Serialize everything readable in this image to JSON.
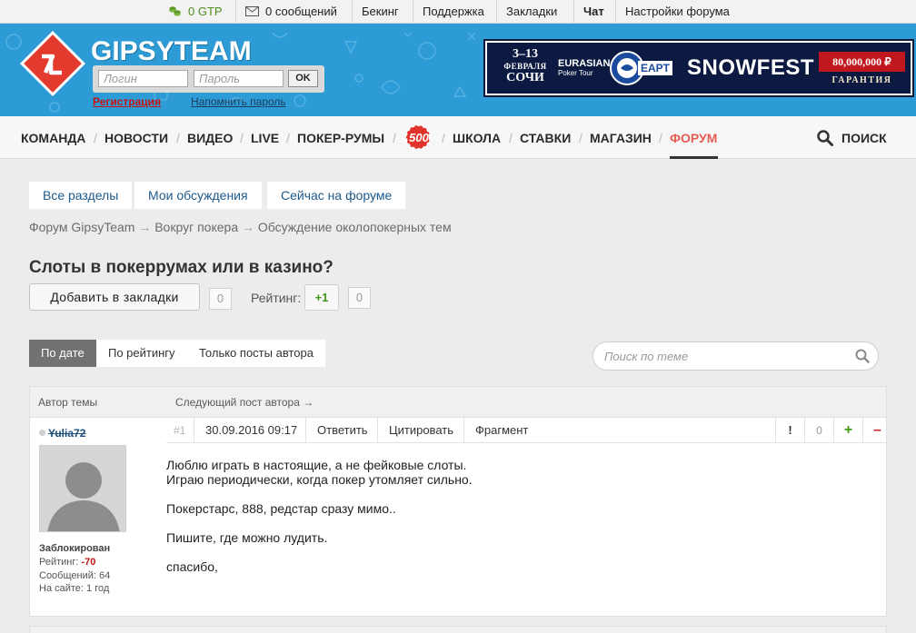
{
  "topbar": {
    "gtp": "0 GTP",
    "messages": "0 сообщений",
    "backing": "Бекинг",
    "support": "Поддержка",
    "bookmarks": "Закладки",
    "chat": "Чат",
    "forum_settings": "Настройки форума"
  },
  "header": {
    "brand": "GIPSYTEAM",
    "login_placeholder": "Логин",
    "password_placeholder": "Пароль",
    "ok_label": "OK",
    "register_link": "Регистрация",
    "remind_link": "Напомнить пароль"
  },
  "banner": {
    "dates_line1": "3–13",
    "dates_line2": "ФЕВРАЛЯ",
    "dates_line3": "СОЧИ",
    "ept_line1": "EURASIAN",
    "ept_line2": "Poker Tour",
    "ept_logo": "EAPT",
    "event": "SNOWFEST",
    "prize": "80,000,000 ₽",
    "guarantee": "ГАРАНТИЯ"
  },
  "nav": {
    "items": [
      "КОМАНДА",
      "НОВОСТИ",
      "ВИДЕО",
      "LIVE",
      "ПОКЕР-РУМЫ",
      "ШКОЛА",
      "СТАВКИ",
      "МАГАЗИН",
      "ФОРУМ"
    ],
    "badge": "500",
    "search_label": "ПОИСК",
    "active_color": "#e55b52"
  },
  "subtabs": [
    "Все разделы",
    "Мои обсуждения",
    "Сейчас на форуме"
  ],
  "breadcrumbs": {
    "forum": "Форум GipsyTeam",
    "arrow": "→",
    "section": "Вокруг покера",
    "subsection": "Обсуждение околопокерных тем"
  },
  "topic": {
    "title": "Слоты в покеррумах или в казино?",
    "bookmark_button": "Добавить в закладки",
    "bookmark_count": "0",
    "rating_label": "Рейтинг:",
    "rating_plus": "+1",
    "rating_count": "0"
  },
  "sort": {
    "by_date": "По дате",
    "by_rating": "По рейтингу",
    "author_only": "Только посты автора",
    "search_placeholder": "Поиск по теме"
  },
  "post": {
    "author_header": "Автор темы",
    "next_post": "Следующий пост автора →",
    "number": "#1",
    "date": "30.09.2016 09:17",
    "reply": "Ответить",
    "quote": "Цитировать",
    "fragment": "Фрагмент",
    "report": "!",
    "votes": "0",
    "plus": "+",
    "minus": "–",
    "author": {
      "name": "Yulia72",
      "status": "Заблокирован",
      "rating_label": "Рейтинг:",
      "rating_value": "-70",
      "messages": "Сообщений: 64",
      "on_site": "На сайте: 1 год"
    },
    "body": [
      "Люблю играть в настоящие, а не фейковые слоты.",
      "Играю периодически, когда покер утомляет сильно.",
      "Покерстарс, 888, редстар сразу мимо..",
      "Пишите, где можно лудить.",
      "спасибо,"
    ]
  },
  "colors": {
    "header_blue": "#2c9bd6",
    "accent_red": "#e55b52",
    "rating_green": "#3f9a14",
    "rating_negative": "#c41414",
    "link_blue": "#1e5a8c"
  }
}
